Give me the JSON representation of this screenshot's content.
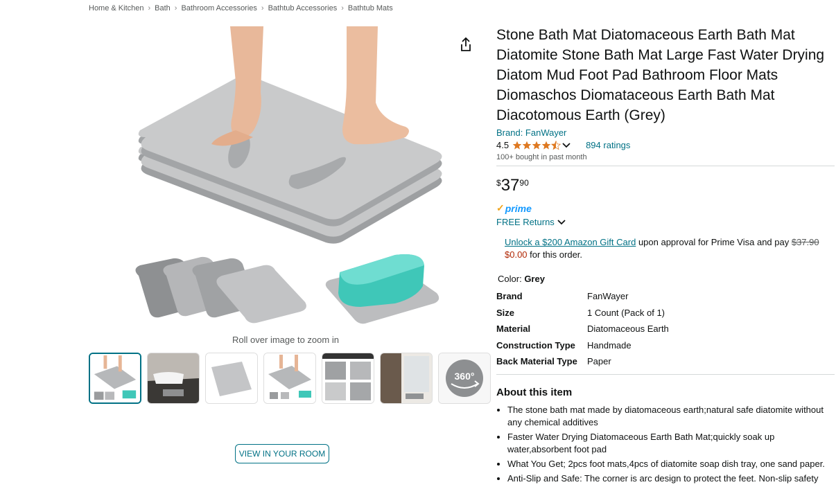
{
  "breadcrumbs": [
    "Home & Kitchen",
    "Bath",
    "Bathroom Accessories",
    "Bathtub Accessories",
    "Bathtub Mats"
  ],
  "gallery": {
    "zoom_hint": "Roll over image to zoom in",
    "view_in_room": "VIEW IN YOUR ROOM",
    "thumb_360_label": "360°"
  },
  "product": {
    "title": "Stone Bath Mat Diatomaceous Earth Bath Mat Diatomite Stone Bath Mat Large Fast Water Drying Diatom Mud Foot Pad Bathroom Floor Mats Diomaschos Diomataceous Earth Bath Mat Diacotomous Earth (Grey)",
    "brand_link": "Brand: FanWayer",
    "rating": "4.5",
    "rating_value": 4.5,
    "ratings_count": "894 ratings",
    "bought": "100+ bought in past month",
    "price_symbol": "$",
    "price_whole": "37",
    "price_fraction": "90",
    "prime_label": "prime",
    "returns": "FREE Returns",
    "offer": {
      "link": "Unlock a $200 Amazon Gift Card",
      "text1": " upon approval for Prime Visa and pay ",
      "strike": "$37.90",
      "red": "$0.00",
      "text2": " for this order."
    },
    "color_label": "Color:",
    "color_value": "Grey",
    "specs": [
      {
        "k": "Brand",
        "v": "FanWayer"
      },
      {
        "k": "Size",
        "v": "1 Count (Pack of 1)"
      },
      {
        "k": "Material",
        "v": "Diatomaceous Earth"
      },
      {
        "k": "Construction Type",
        "v": "Handmade"
      },
      {
        "k": "Back Material Type",
        "v": "Paper"
      }
    ],
    "about_title": "About this item",
    "bullets": [
      "The stone bath mat made by diatomaceous earth;natural safe diatomite without any chemical additives",
      "Faster Water Drying Diatomaceous Earth Bath Mat;quickly soak up water,absorbent foot pad",
      "What You Get; 2pcs foot mats,4pcs of diatomite soap dish tray, one sand paper.",
      "Anti-Slip and Safe: The corner is arc design to protect the feet. Non-slip safety"
    ]
  },
  "colors": {
    "link": "#007185",
    "star": "#de7921",
    "prime": "#1399ff",
    "price_red": "#b12704"
  }
}
